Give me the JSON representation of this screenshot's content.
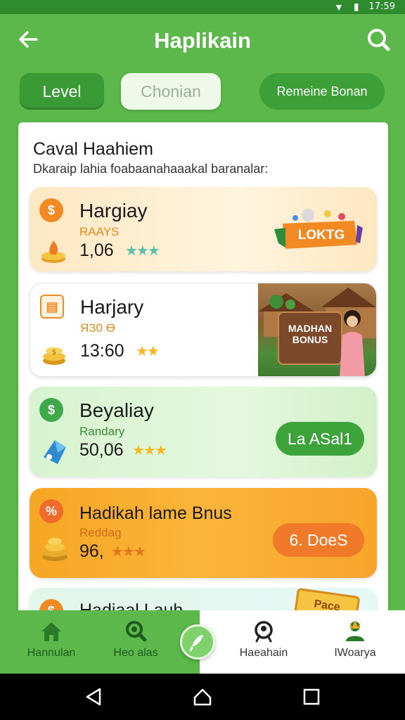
{
  "status_bar": {
    "time": "17:59"
  },
  "app_bar": {
    "title": "Haplikain"
  },
  "tabs": [
    {
      "label": "Level",
      "active": true
    },
    {
      "label": "Chonian",
      "active": false
    },
    {
      "label": "Remeine Bonan",
      "active": false
    }
  ],
  "panel": {
    "title": "Caval Haahiem",
    "subtitle": "Dkaraip lahia foabaanahaaakal baranalar:"
  },
  "cards": [
    {
      "title": "Hargiay",
      "sub": "RAAYS",
      "value": "1,06",
      "stars": "★★★",
      "badge": "LOKTG"
    },
    {
      "title": "Harjary",
      "sub": "ЯЗ0 Ө",
      "value": "13:60",
      "stars": "★★",
      "sign_line1": "MADHAN",
      "sign_line2": "BONUS"
    },
    {
      "title": "Beyaliay",
      "sub": "Randary",
      "value": "50,06",
      "stars": "★★★",
      "button": "La ASal1"
    },
    {
      "title": "Hadikah lame Bnus",
      "sub": "Reddag",
      "value": "96,",
      "stars": "★★★",
      "button": "6. DoeS"
    },
    {
      "title": "Hadiaal Lauh",
      "badge": "Pace"
    }
  ],
  "bottom_nav": [
    {
      "label": "Hannulan",
      "icon": "home-icon"
    },
    {
      "label": "Heo alas",
      "icon": "search-icon"
    },
    {
      "label": "Haeahain",
      "icon": "location-icon"
    },
    {
      "label": "IWoarya",
      "icon": "profile-icon"
    }
  ],
  "colors": {
    "primary_green": "#5cb84a",
    "dark_green": "#3a9a35",
    "orange": "#f5a623",
    "pill_orange": "#f07a2a"
  }
}
